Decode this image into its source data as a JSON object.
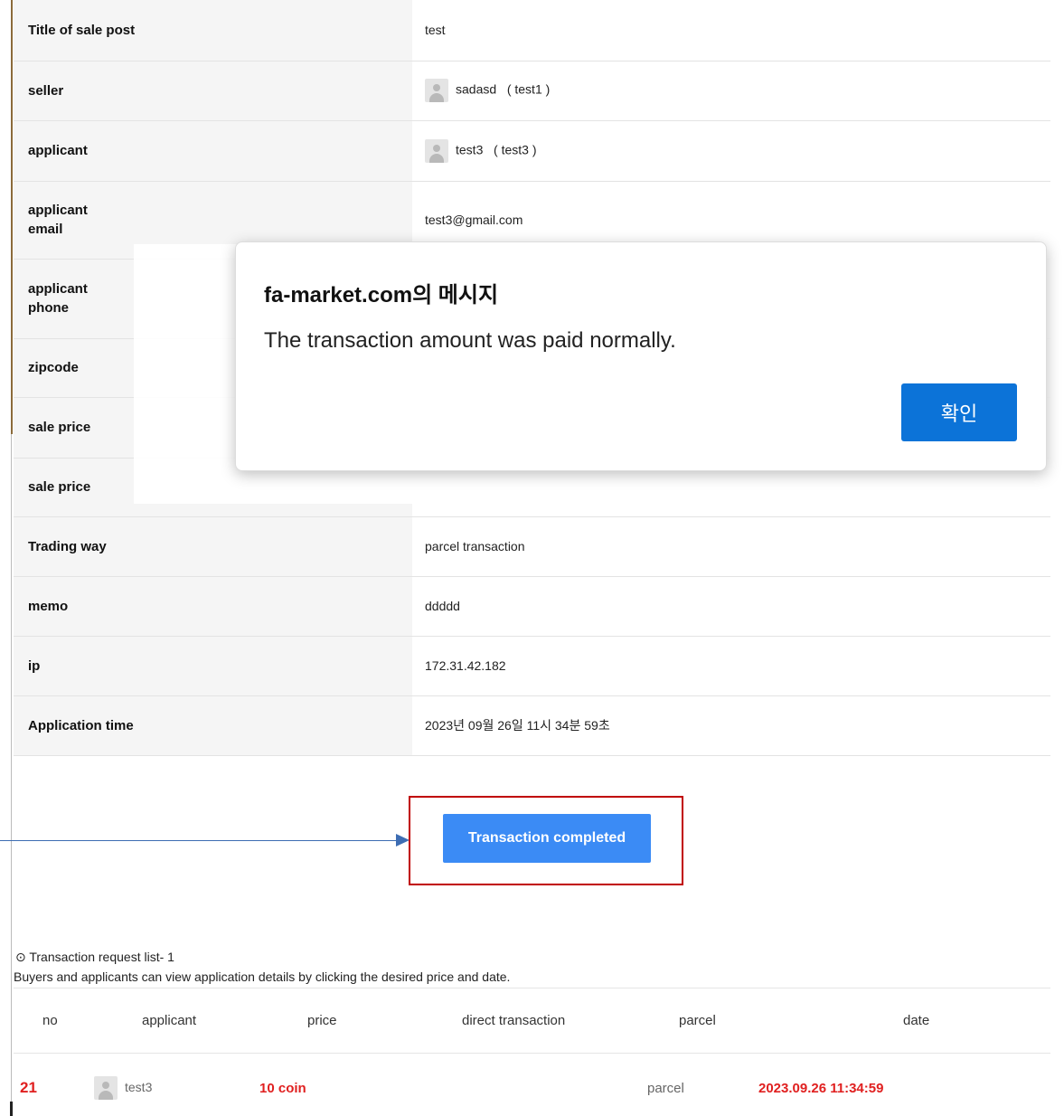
{
  "detail_rows": [
    {
      "label": "Title of sale post",
      "value": "test"
    },
    {
      "label": "seller",
      "value_name": "sadasd",
      "value_id": "( test1 )"
    },
    {
      "label": "applicant",
      "value_name": "test3",
      "value_id": "( test3 )"
    },
    {
      "label": "applicant\nemail",
      "value": "test3@gmail.com"
    },
    {
      "label": "applicant\nphone",
      "value": ""
    },
    {
      "label": "zipcode",
      "value": ""
    },
    {
      "label": "sale price",
      "value": ""
    },
    {
      "label": "sale price",
      "value": ""
    },
    {
      "label": "Trading way",
      "value": "parcel transaction"
    },
    {
      "label": "memo",
      "value": "ddddd"
    },
    {
      "label": "ip",
      "value": "172.31.42.182"
    },
    {
      "label": "Application time",
      "value": "2023년 09월 26일 11시 34분 59초"
    }
  ],
  "dialog": {
    "title": "fa-market.com의 메시지",
    "message": "The transaction amount was paid normally.",
    "ok_label": "확인"
  },
  "complete_button_label": "Transaction completed",
  "request_list": {
    "title": "⊙ Transaction request list- 1",
    "description": "Buyers and applicants can view application details by clicking the desired price and date.",
    "headers": [
      "no",
      "applicant",
      "price",
      "direct transaction",
      "parcel",
      "date"
    ],
    "rows": [
      {
        "no": "21",
        "applicant": "test3",
        "price": "10 coin",
        "direct": "",
        "parcel": "parcel",
        "date": "2023.09.26 11:34:59"
      }
    ]
  },
  "colors": {
    "accent": "#3b8bf5",
    "dialog_button": "#0c73d8",
    "highlight": "#c00000",
    "price_red": "#e02020"
  }
}
